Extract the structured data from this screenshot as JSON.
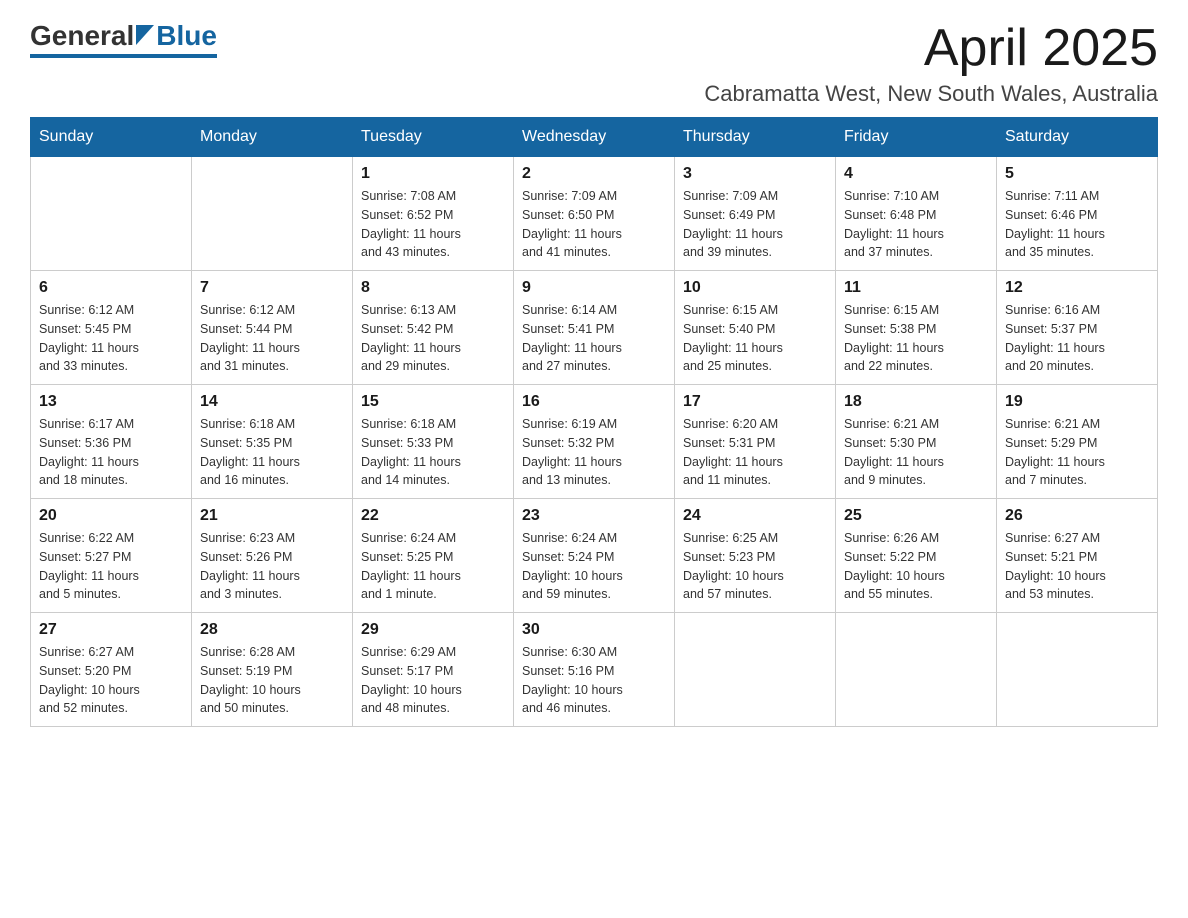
{
  "header": {
    "logo_general": "General",
    "logo_blue": "Blue",
    "month_title": "April 2025",
    "location": "Cabramatta West, New South Wales, Australia"
  },
  "calendar": {
    "days_of_week": [
      "Sunday",
      "Monday",
      "Tuesday",
      "Wednesday",
      "Thursday",
      "Friday",
      "Saturday"
    ],
    "weeks": [
      [
        {
          "day": "",
          "info": ""
        },
        {
          "day": "",
          "info": ""
        },
        {
          "day": "1",
          "info": "Sunrise: 7:08 AM\nSunset: 6:52 PM\nDaylight: 11 hours\nand 43 minutes."
        },
        {
          "day": "2",
          "info": "Sunrise: 7:09 AM\nSunset: 6:50 PM\nDaylight: 11 hours\nand 41 minutes."
        },
        {
          "day": "3",
          "info": "Sunrise: 7:09 AM\nSunset: 6:49 PM\nDaylight: 11 hours\nand 39 minutes."
        },
        {
          "day": "4",
          "info": "Sunrise: 7:10 AM\nSunset: 6:48 PM\nDaylight: 11 hours\nand 37 minutes."
        },
        {
          "day": "5",
          "info": "Sunrise: 7:11 AM\nSunset: 6:46 PM\nDaylight: 11 hours\nand 35 minutes."
        }
      ],
      [
        {
          "day": "6",
          "info": "Sunrise: 6:12 AM\nSunset: 5:45 PM\nDaylight: 11 hours\nand 33 minutes."
        },
        {
          "day": "7",
          "info": "Sunrise: 6:12 AM\nSunset: 5:44 PM\nDaylight: 11 hours\nand 31 minutes."
        },
        {
          "day": "8",
          "info": "Sunrise: 6:13 AM\nSunset: 5:42 PM\nDaylight: 11 hours\nand 29 minutes."
        },
        {
          "day": "9",
          "info": "Sunrise: 6:14 AM\nSunset: 5:41 PM\nDaylight: 11 hours\nand 27 minutes."
        },
        {
          "day": "10",
          "info": "Sunrise: 6:15 AM\nSunset: 5:40 PM\nDaylight: 11 hours\nand 25 minutes."
        },
        {
          "day": "11",
          "info": "Sunrise: 6:15 AM\nSunset: 5:38 PM\nDaylight: 11 hours\nand 22 minutes."
        },
        {
          "day": "12",
          "info": "Sunrise: 6:16 AM\nSunset: 5:37 PM\nDaylight: 11 hours\nand 20 minutes."
        }
      ],
      [
        {
          "day": "13",
          "info": "Sunrise: 6:17 AM\nSunset: 5:36 PM\nDaylight: 11 hours\nand 18 minutes."
        },
        {
          "day": "14",
          "info": "Sunrise: 6:18 AM\nSunset: 5:35 PM\nDaylight: 11 hours\nand 16 minutes."
        },
        {
          "day": "15",
          "info": "Sunrise: 6:18 AM\nSunset: 5:33 PM\nDaylight: 11 hours\nand 14 minutes."
        },
        {
          "day": "16",
          "info": "Sunrise: 6:19 AM\nSunset: 5:32 PM\nDaylight: 11 hours\nand 13 minutes."
        },
        {
          "day": "17",
          "info": "Sunrise: 6:20 AM\nSunset: 5:31 PM\nDaylight: 11 hours\nand 11 minutes."
        },
        {
          "day": "18",
          "info": "Sunrise: 6:21 AM\nSunset: 5:30 PM\nDaylight: 11 hours\nand 9 minutes."
        },
        {
          "day": "19",
          "info": "Sunrise: 6:21 AM\nSunset: 5:29 PM\nDaylight: 11 hours\nand 7 minutes."
        }
      ],
      [
        {
          "day": "20",
          "info": "Sunrise: 6:22 AM\nSunset: 5:27 PM\nDaylight: 11 hours\nand 5 minutes."
        },
        {
          "day": "21",
          "info": "Sunrise: 6:23 AM\nSunset: 5:26 PM\nDaylight: 11 hours\nand 3 minutes."
        },
        {
          "day": "22",
          "info": "Sunrise: 6:24 AM\nSunset: 5:25 PM\nDaylight: 11 hours\nand 1 minute."
        },
        {
          "day": "23",
          "info": "Sunrise: 6:24 AM\nSunset: 5:24 PM\nDaylight: 10 hours\nand 59 minutes."
        },
        {
          "day": "24",
          "info": "Sunrise: 6:25 AM\nSunset: 5:23 PM\nDaylight: 10 hours\nand 57 minutes."
        },
        {
          "day": "25",
          "info": "Sunrise: 6:26 AM\nSunset: 5:22 PM\nDaylight: 10 hours\nand 55 minutes."
        },
        {
          "day": "26",
          "info": "Sunrise: 6:27 AM\nSunset: 5:21 PM\nDaylight: 10 hours\nand 53 minutes."
        }
      ],
      [
        {
          "day": "27",
          "info": "Sunrise: 6:27 AM\nSunset: 5:20 PM\nDaylight: 10 hours\nand 52 minutes."
        },
        {
          "day": "28",
          "info": "Sunrise: 6:28 AM\nSunset: 5:19 PM\nDaylight: 10 hours\nand 50 minutes."
        },
        {
          "day": "29",
          "info": "Sunrise: 6:29 AM\nSunset: 5:17 PM\nDaylight: 10 hours\nand 48 minutes."
        },
        {
          "day": "30",
          "info": "Sunrise: 6:30 AM\nSunset: 5:16 PM\nDaylight: 10 hours\nand 46 minutes."
        },
        {
          "day": "",
          "info": ""
        },
        {
          "day": "",
          "info": ""
        },
        {
          "day": "",
          "info": ""
        }
      ]
    ]
  }
}
